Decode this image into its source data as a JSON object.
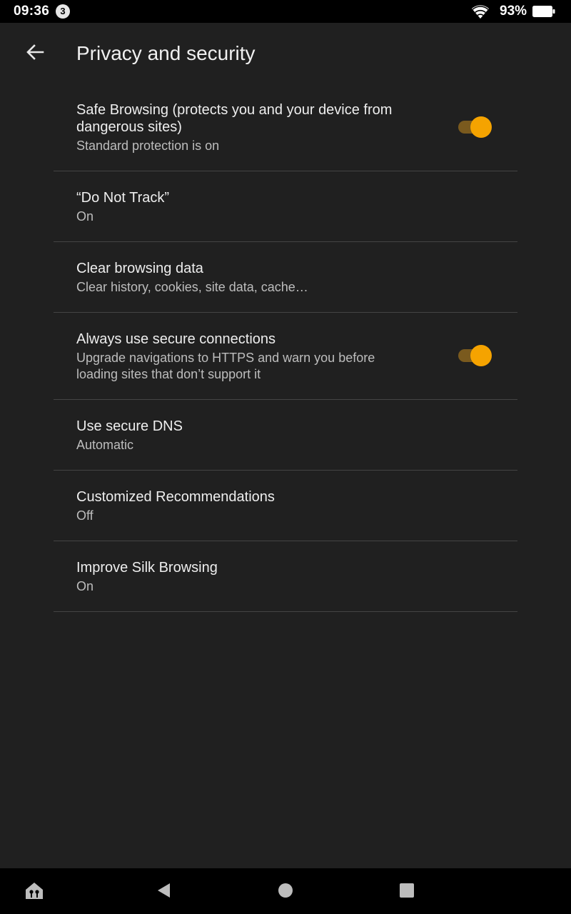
{
  "status_bar": {
    "time": "09:36",
    "notification_count": "3",
    "battery_percent": "93%"
  },
  "toolbar": {
    "title": "Privacy and security"
  },
  "settings": [
    {
      "title": "Safe Browsing (protects you and your device from dangerous sites)",
      "summary": "Standard protection is on",
      "toggle": true
    },
    {
      "title": "“Do Not Track”",
      "summary": "On"
    },
    {
      "title": "Clear browsing data",
      "summary": "Clear history, cookies, site data, cache…"
    },
    {
      "title": "Always use secure connections",
      "summary": "Upgrade navigations to HTTPS and warn you before loading sites that don’t support it",
      "toggle": true
    },
    {
      "title": "Use secure DNS",
      "summary": "Automatic"
    },
    {
      "title": "Customized Recommendations",
      "summary": "Off"
    },
    {
      "title": "Improve Silk Browsing",
      "summary": "On"
    }
  ],
  "colors": {
    "background": "#202020",
    "accent": "#f5a300",
    "divider": "#444444"
  },
  "icons": {
    "back": "arrow-left-icon",
    "wifi": "wifi-icon",
    "battery": "battery-icon",
    "nav_home_launcher": "home-launcher-icon",
    "nav_back": "triangle-back-icon",
    "nav_home": "circle-home-icon",
    "nav_recents": "square-recents-icon"
  }
}
